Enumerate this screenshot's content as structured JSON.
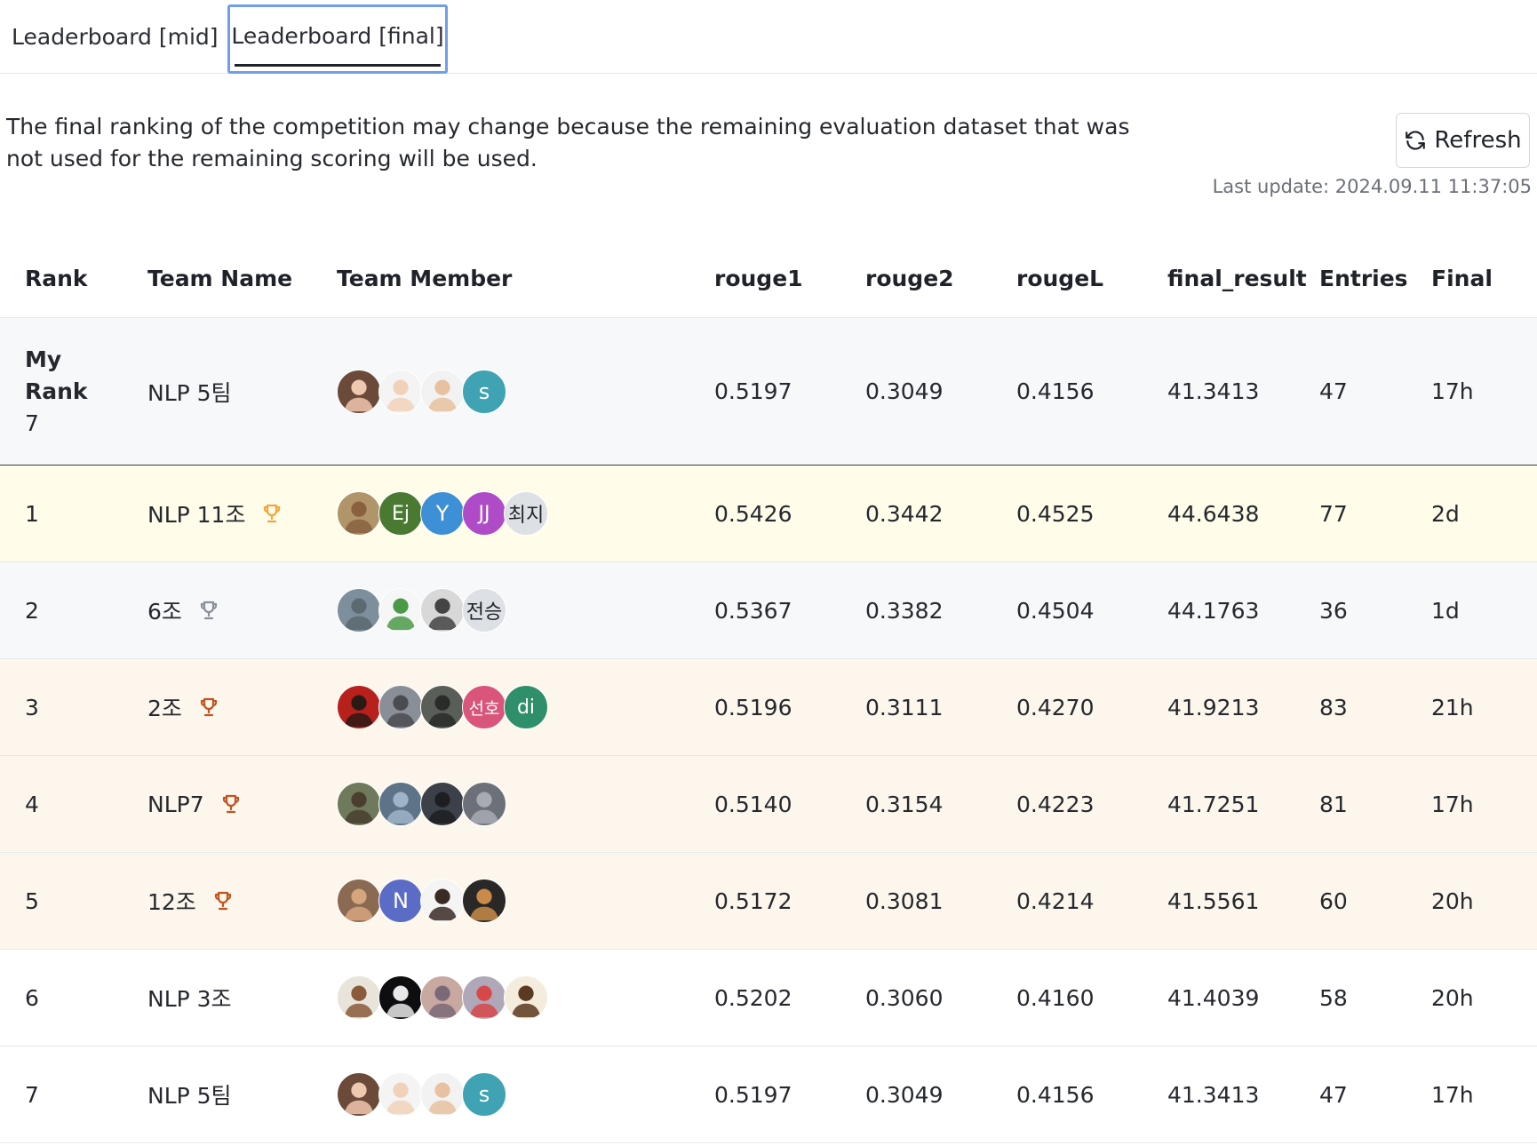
{
  "tabs": [
    {
      "label": "Leaderboard [mid]",
      "active": false
    },
    {
      "label": "Leaderboard [final]",
      "active": true
    }
  ],
  "notice": "The final ranking of the competition may change because the remaining evaluation dataset that was not used for the remaining scoring will be used.",
  "refresh_label": "Refresh",
  "last_update": "Last update: 2024.09.11 11:37:05",
  "columns": {
    "rank": "Rank",
    "team": "Team Name",
    "member": "Team Member",
    "rouge1": "rouge1",
    "rouge2": "rouge2",
    "rougeL": "rougeL",
    "final_result": "final_result",
    "entries": "Entries",
    "final": "Final"
  },
  "my_rank": {
    "label_my": "My",
    "label_rank": "Rank",
    "rank": "7",
    "team": "NLP 5팀",
    "members": [
      {
        "type": "photo",
        "color": "#6b4a3a",
        "face": "#f0c7b0"
      },
      {
        "type": "photo",
        "color": "#f4f4f4",
        "face": "#f1d2b8"
      },
      {
        "type": "photo",
        "color": "#f2f2f2",
        "face": "#e8c2a0"
      },
      {
        "type": "letter",
        "text": "s",
        "color": "#3fa3b4"
      }
    ],
    "rouge1": "0.5197",
    "rouge2": "0.3049",
    "rougeL": "0.4156",
    "final_result": "41.3413",
    "entries": "47",
    "final": "17h"
  },
  "rows": [
    {
      "rank": "1",
      "team": "NLP 11조",
      "trophy": "gold",
      "trophy_color": "#f0a63c",
      "members": [
        {
          "type": "photo",
          "color": "#b0956a",
          "face": "#8a6040"
        },
        {
          "type": "letter",
          "text": "Ej",
          "color": "#4a7a32"
        },
        {
          "type": "letter",
          "text": "Y",
          "color": "#3d8fd6"
        },
        {
          "type": "letter",
          "text": "JJ",
          "color": "#b04bc7"
        },
        {
          "type": "letter",
          "text": "최지",
          "color": "#dde0e4",
          "dark": true
        }
      ],
      "rouge1": "0.5426",
      "rouge2": "0.3442",
      "rougeL": "0.4525",
      "final_result": "44.6438",
      "entries": "77",
      "final": "2d"
    },
    {
      "rank": "2",
      "team": "6조",
      "trophy": "silver",
      "trophy_color": "#8a9099",
      "members": [
        {
          "type": "photo",
          "color": "#7d8f9c",
          "face": "#5b6a70"
        },
        {
          "type": "photo",
          "color": "#f6f6f6",
          "face": "#4a9a48"
        },
        {
          "type": "photo",
          "color": "#d8d8d8",
          "face": "#444444"
        },
        {
          "type": "letter",
          "text": "전승",
          "color": "#dde0e4",
          "dark": true
        }
      ],
      "rouge1": "0.5367",
      "rouge2": "0.3382",
      "rougeL": "0.4504",
      "final_result": "44.1763",
      "entries": "36",
      "final": "1d"
    },
    {
      "rank": "3",
      "team": "2조",
      "trophy": "bronze",
      "trophy_color": "#c0531f",
      "members": [
        {
          "type": "photo",
          "color": "#b8201c",
          "face": "#2a1a16"
        },
        {
          "type": "photo",
          "color": "#8a8e96",
          "face": "#4a4c52"
        },
        {
          "type": "photo",
          "color": "#5a5e58",
          "face": "#2a2c2a"
        },
        {
          "type": "letter",
          "text": "선호",
          "color": "#d9557a",
          "small": true
        },
        {
          "type": "letter",
          "text": "di",
          "color": "#2f8f6a"
        }
      ],
      "rouge1": "0.5196",
      "rouge2": "0.3111",
      "rougeL": "0.4270",
      "final_result": "41.9213",
      "entries": "83",
      "final": "21h"
    },
    {
      "rank": "4",
      "team": "NLP7",
      "trophy": "bronze",
      "trophy_color": "#c0531f",
      "members": [
        {
          "type": "photo",
          "color": "#6f7a5c",
          "face": "#4a3e2e"
        },
        {
          "type": "photo",
          "color": "#5d7388",
          "face": "#9fb4c8"
        },
        {
          "type": "photo",
          "color": "#3c4048",
          "face": "#1c1e22"
        },
        {
          "type": "photo",
          "color": "#6c7078",
          "face": "#a8acb2"
        }
      ],
      "rouge1": "0.5140",
      "rouge2": "0.3154",
      "rougeL": "0.4223",
      "final_result": "41.7251",
      "entries": "81",
      "final": "17h"
    },
    {
      "rank": "5",
      "team": "12조",
      "trophy": "bronze",
      "trophy_color": "#c0531f",
      "members": [
        {
          "type": "photo",
          "color": "#8a6a52",
          "face": "#d6a57e"
        },
        {
          "type": "letter",
          "text": "N",
          "color": "#5a6cc6"
        },
        {
          "type": "photo",
          "color": "#f4f4f4",
          "face": "#3a2a24"
        },
        {
          "type": "photo",
          "color": "#2a2826",
          "face": "#c98a4a"
        }
      ],
      "rouge1": "0.5172",
      "rouge2": "0.3081",
      "rougeL": "0.4214",
      "final_result": "41.5561",
      "entries": "60",
      "final": "20h"
    },
    {
      "rank": "6",
      "team": "NLP 3조",
      "members": [
        {
          "type": "photo",
          "color": "#e8e4dc",
          "face": "#8a5a3a"
        },
        {
          "type": "photo",
          "color": "#0e0e10",
          "face": "#e8e8e8"
        },
        {
          "type": "photo",
          "color": "#c8a8a0",
          "face": "#7a6a78"
        },
        {
          "type": "photo",
          "color": "#b0a8b8",
          "face": "#d84848"
        },
        {
          "type": "photo",
          "color": "#f4ecdc",
          "face": "#5a3a20"
        }
      ],
      "rouge1": "0.5202",
      "rouge2": "0.3060",
      "rougeL": "0.4160",
      "final_result": "41.4039",
      "entries": "58",
      "final": "20h"
    },
    {
      "rank": "7",
      "team": "NLP 5팀",
      "members": [
        {
          "type": "photo",
          "color": "#6b4a3a",
          "face": "#f0c7b0"
        },
        {
          "type": "photo",
          "color": "#f4f4f4",
          "face": "#f1d2b8"
        },
        {
          "type": "photo",
          "color": "#f2f2f2",
          "face": "#e8c2a0"
        },
        {
          "type": "letter",
          "text": "s",
          "color": "#3fa3b4"
        }
      ],
      "rouge1": "0.5197",
      "rouge2": "0.3049",
      "rougeL": "0.4156",
      "final_result": "41.3413",
      "entries": "47",
      "final": "17h"
    }
  ]
}
